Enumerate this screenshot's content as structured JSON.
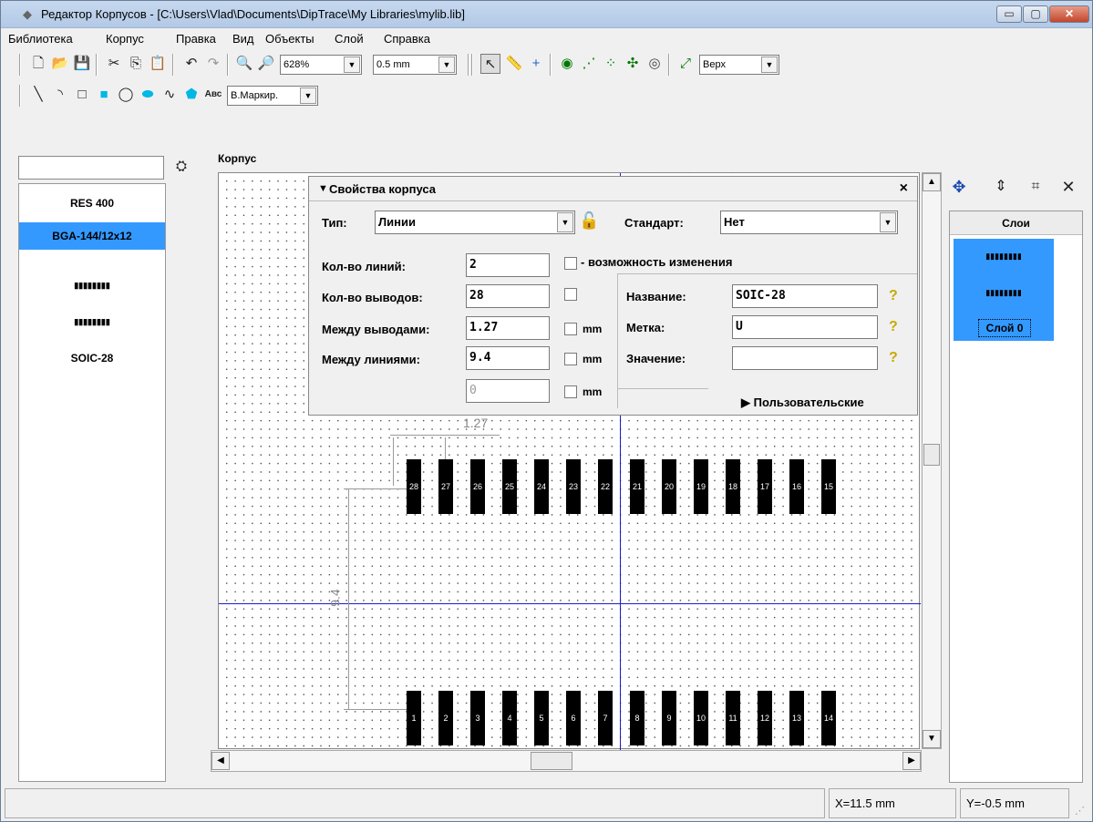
{
  "window": {
    "title": "Редактор Корпусов - [C:\\Users\\Vlad\\Documents\\DipTrace\\My Libraries\\mylib.lib]",
    "minimize": "▭",
    "maximize": "▢",
    "close": "✕"
  },
  "menu": [
    "Библиотека",
    "Корпус",
    "Правка",
    "Вид",
    "Объекты",
    "Слой",
    "Справка"
  ],
  "toolbar1": {
    "zoom": "628%",
    "grid": "0.5 mm",
    "layer": "Верх"
  },
  "toolbar2": {
    "abc": "Авс",
    "marking": "В.Маркир."
  },
  "library": {
    "items": [
      "RES 400",
      "BGA-144/12x12",
      "▮▮▮▮▮▮▮▮",
      "▮▮▮▮▮▮▮▮",
      "SOIC-28"
    ],
    "selected_index": 1
  },
  "group_label": "Корпус",
  "dialog": {
    "title": "Свойства корпуса",
    "close": "×",
    "type_label": "Тип:",
    "type_value": "Линии",
    "standard_label": "Стандарт:",
    "standard_value": "Нет",
    "lines_count_label": "Кол-во линий:",
    "lines_count_value": "2",
    "editable_label": "- возможность изменения",
    "pins_count_label": "Кол-во выводов:",
    "pins_count_value": "28",
    "pitch_label": "Между выводами:",
    "pitch_value": "1.27",
    "lines_dist_label": "Между линиями:",
    "lines_dist_value": "9.4",
    "extra_value": "0",
    "unit": "mm",
    "name_label": "Название:",
    "name_value": "SOIC-28",
    "ref_label": "Метка:",
    "ref_value": "U",
    "value_label": "Значение:",
    "value_value": "",
    "custom_label": "▶ Пользовательские"
  },
  "canvas": {
    "dim_pitch": "1.27",
    "dim_lines": "9.4",
    "top_pads": [
      "28",
      "27",
      "26",
      "25",
      "24",
      "23",
      "22",
      "21",
      "20",
      "19",
      "18",
      "17",
      "16",
      "15"
    ],
    "bottom_pads": [
      "1",
      "2",
      "3",
      "4",
      "5",
      "6",
      "7",
      "8",
      "9",
      "10",
      "11",
      "12",
      "13",
      "14"
    ]
  },
  "layers": {
    "header": "Слои",
    "items": [
      "▮▮▮▮▮▮▮▮",
      "▮▮▮▮▮▮▮▮"
    ],
    "layer0": "Слой 0"
  },
  "status": {
    "x": "X=11.5 mm",
    "y": "Y=-0.5 mm"
  },
  "colors": {
    "selection": "#3399ff",
    "axis": "#0000cc",
    "pad": "#000000"
  }
}
